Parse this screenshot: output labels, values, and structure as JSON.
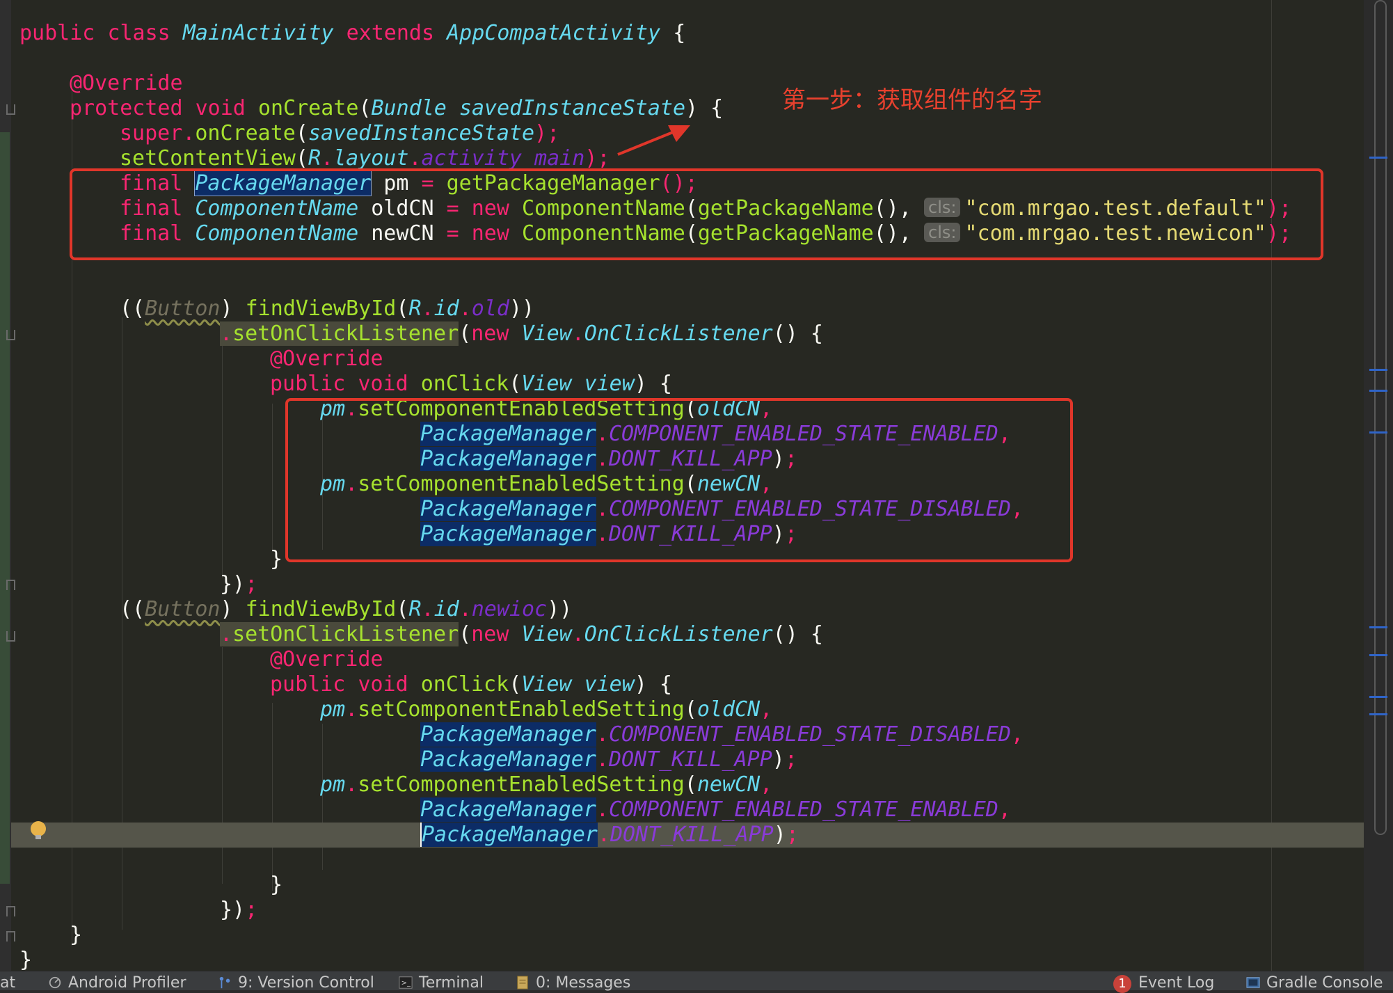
{
  "code": {
    "class_decl": {
      "kw1": "public",
      "kw2": "class",
      "name": "MainActivity",
      "kw3": "extends",
      "parent": "AppCompatActivity",
      "brace": " {"
    },
    "override1": "@Override",
    "oncreate": {
      "kw1": "protected",
      "kw2": "void",
      "name": "onCreate",
      "type": "Bundle",
      "param": "savedInstanceState",
      "tail": ") {"
    },
    "super_call": {
      "kw": "super",
      "dot": ".",
      "fn": "onCreate",
      "arg": "savedInstanceState",
      "end": ");"
    },
    "setcontent": {
      "fn": "setContentView",
      "r": "R",
      "layout": "layout",
      "res": "activity_main",
      "end": ");"
    },
    "pm_line": {
      "kw": "final",
      "type": "PackageManager",
      "var": "pm",
      "eq": "=",
      "call": "getPackageManager",
      "end": "();"
    },
    "old_line": {
      "kw": "final",
      "type": "ComponentName",
      "var": "oldCN",
      "eq": "=",
      "new": "new",
      "ctor": "ComponentName",
      "arg1": "getPackageName",
      "hint": "cls:",
      "str": "\"com.mrgao.test.default\"",
      "end": ");"
    },
    "new_line": {
      "kw": "final",
      "type": "ComponentName",
      "var": "newCN",
      "eq": "=",
      "new": "new",
      "ctor": "ComponentName",
      "arg1": "getPackageName",
      "hint": "cls:",
      "str": "\"com.mrgao.test.newicon\"",
      "end": ");"
    },
    "btn1": {
      "cast": "Button",
      "fn": "findViewById",
      "r": "R",
      "id": "id",
      "res": "old"
    },
    "btn2": {
      "cast": "Button",
      "fn": "findViewById",
      "r": "R",
      "id": "id",
      "res": "newioc"
    },
    "listener": {
      "fn": "setOnClickListener",
      "new": "new",
      "type1": "View",
      "type2": "OnClickListener",
      "tail": "() {"
    },
    "override2": "@Override",
    "onclick": {
      "kw1": "public",
      "kw2": "void",
      "name": "onClick",
      "type": "View",
      "param": "view",
      "tail": ") {"
    },
    "pm": "pm",
    "setting_fn": "setComponentEnabledSetting",
    "pkgmgr": "PackageManager",
    "enabled": "COMPONENT_ENABLED_STATE_ENABLED",
    "disabled": "COMPONENT_ENABLED_STATE_DISABLED",
    "dontkill": "DONT_KILL_APP",
    "oldCN": "oldCN",
    "newCN": "newCN",
    "close_brace": "}",
    "close_call": "});"
  },
  "annotation": "第一步：获取组件的名字",
  "statusbar": {
    "items": [
      {
        "label": "at"
      },
      {
        "label": "Android Profiler"
      },
      {
        "label": "9: Version Control"
      },
      {
        "label": "Terminal"
      },
      {
        "label": "0: Messages"
      }
    ],
    "event_count": "1",
    "event_log": "Event Log",
    "gradle": "Gradle Console"
  },
  "colors": {
    "background": "#272822",
    "keyword": "#f92672",
    "type": "#66d9ef",
    "function": "#a6e22e",
    "string": "#e6db74",
    "constant": "#8a3bd8",
    "annotation_box": "#e0362a"
  }
}
